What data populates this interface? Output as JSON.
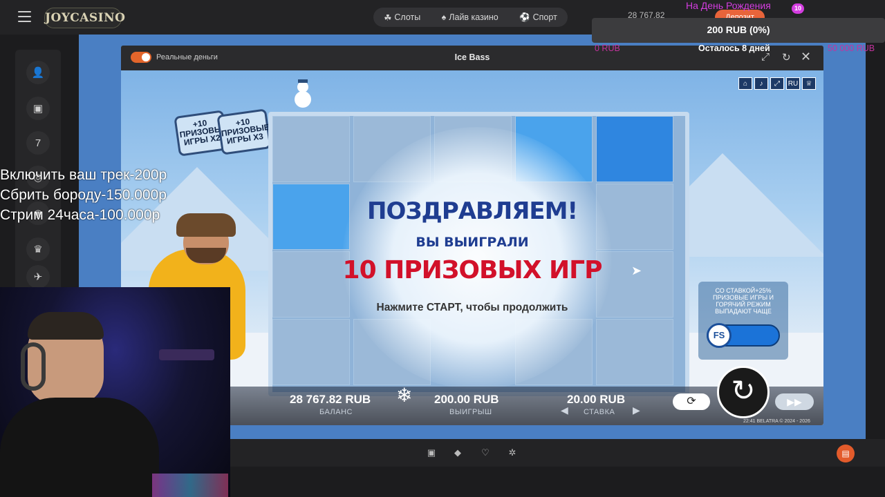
{
  "header": {
    "logo": "JOYCASINO",
    "nav": [
      {
        "label": "Слоты",
        "icon": "slots-icon"
      },
      {
        "label": "Лайв казино",
        "icon": "live-casino-icon"
      },
      {
        "label": "Спорт",
        "icon": "soccer-ball-icon"
      }
    ],
    "balance": "28 767.82",
    "deposit": "Депозит"
  },
  "promo_overlay": {
    "title": "На День Рождения",
    "badge": "10",
    "amount": "200 RUB (0%)",
    "min": "0 RUB",
    "remaining": "Осталось 8 дней",
    "max": "50 000 RUB"
  },
  "stream_overlay": {
    "lines": [
      "Включить ваш трек-200р",
      "Сбрить бороду-150.000р",
      "Стрим 24часа-100.000р"
    ]
  },
  "game": {
    "real_money_label": "Реальные деньги",
    "title": "Ice Bass",
    "top_icons": [
      "home-icon",
      "sound-icon",
      "fullscreen-icon",
      "RU",
      "trophy-icon"
    ],
    "badges": [
      {
        "text": "+10 ПРИЗОВЫ ИГРЫ X2"
      },
      {
        "text": "+10 ПРИЗОВЫЕ ИГРЫ X3"
      }
    ],
    "popup": {
      "congrats": "ПОЗДРАВЛЯЕМ!",
      "you_won": "ВЫ ВЫИГРАЛИ",
      "prize": "10 ПРИЗОВЫХ ИГР",
      "press_start": "Нажмите СТАРТ, чтобы продолжить"
    },
    "feature_box": {
      "text": "СО СТАВКОЙ+25% ПРИЗОВЫЕ ИГРЫ И ГОРЯЧИЙ РЕЖИМ ВЫПАДАЮТ ЧАЩЕ",
      "button": "FS"
    },
    "balance": {
      "value": "28 767.82 RUB",
      "label": "БАЛАНС"
    },
    "win": {
      "value": "200.00 RUB",
      "label": "ВЫИГРЫШ"
    },
    "bet": {
      "value": "20.00 RUB",
      "label": "СТАВКА"
    },
    "copyright": "22:41  BELATRA © 2024 - 2026"
  },
  "sidebar": {
    "icons": [
      "user-icon",
      "wallet-icon",
      "slots-icon",
      "tournaments-icon",
      "crown-icon",
      "aviator-icon"
    ]
  },
  "footer": {
    "icons": [
      "gift-icon",
      "ticket-icon",
      "heart-icon",
      "settings-icon"
    ]
  }
}
